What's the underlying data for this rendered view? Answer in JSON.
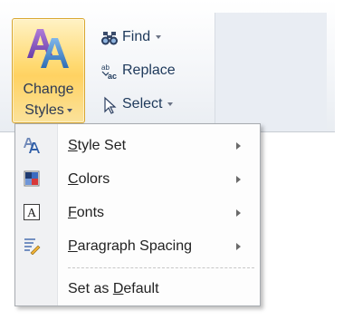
{
  "ribbon": {
    "change_styles": {
      "label_line1": "Change",
      "label_line2": "Styles",
      "icon": "change-styles-aa-icon"
    },
    "editing": {
      "find": {
        "label": "Find",
        "icon": "binoculars-icon"
      },
      "replace": {
        "label": "Replace",
        "icon": "replace-ab-ac-icon"
      },
      "select": {
        "label": "Select",
        "icon": "cursor-arrow-icon"
      }
    }
  },
  "menu": {
    "items": [
      {
        "pre": "",
        "mnemonic": "S",
        "post": "tyle Set",
        "icon": "style-set-aa-icon",
        "has_submenu": true
      },
      {
        "pre": "",
        "mnemonic": "C",
        "post": "olors",
        "icon": "color-swatch-icon",
        "has_submenu": true
      },
      {
        "pre": "",
        "mnemonic": "F",
        "post": "onts",
        "icon": "font-a-icon",
        "has_submenu": true
      },
      {
        "pre": "",
        "mnemonic": "P",
        "post": "aragraph Spacing",
        "icon": "paragraph-spacing-icon",
        "has_submenu": true
      },
      {
        "pre": "Set as ",
        "mnemonic": "D",
        "post": "efault",
        "icon": "",
        "has_submenu": false
      }
    ]
  },
  "colors": {
    "highlight_border": "#d9a72f",
    "highlight_fill": "#ffd970",
    "ribbon_text": "#1e395b",
    "menu_border": "#a7abb0"
  }
}
